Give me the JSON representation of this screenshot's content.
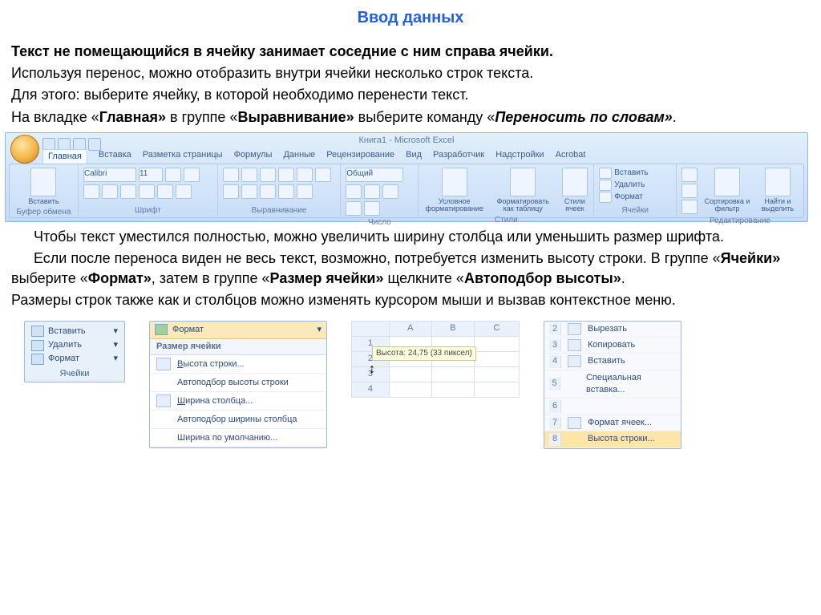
{
  "title": "Ввод данных",
  "para1_bold": "Текст не помещающийся в ячейку занимает соседние с ним справа ячейки.",
  "para2": "Используя перенос, можно отобразить внутри ячейки несколько строк текста.",
  "para3": "Для этого: выберите ячейку, в которой необходимо перенести текст.",
  "para4_prefix": "На вкладке «",
  "para4_b1": "Главная»",
  "para4_mid": " в группе «",
  "para4_b2": "Выравнивание»",
  "para4_mid2": " выберите команду «",
  "para4_bi": "Переносить по словам»",
  "para4_suffix": ".",
  "ribbon": {
    "window_title": "Книга1 - Microsoft Excel",
    "tabs": [
      "Главная",
      "Вставка",
      "Разметка страницы",
      "Формулы",
      "Данные",
      "Рецензирование",
      "Вид",
      "Разработчик",
      "Надстройки",
      "Acrobat"
    ],
    "groups": [
      "Буфер обмена",
      "Шрифт",
      "Выравнивание",
      "Число",
      "Стили",
      "Ячейки",
      "Редактирование"
    ],
    "big_labels": {
      "paste": "Вставить",
      "cond": "Условное форматирование",
      "fmt_tbl": "Форматировать как таблицу",
      "styles": "Стили ячеек",
      "sort": "Сортировка и фильтр",
      "find": "Найти и выделить"
    },
    "cell_ops": [
      "Вставить",
      "Удалить",
      "Формат"
    ],
    "font_name": "Calibri",
    "font_size": "11",
    "number_fmt": "Общий"
  },
  "para5_a": "Чтобы текст уместился полностью, можно увеличить ширину столбца или уменьшить размер шрифта.",
  "para6_a": "Если после переноса виден не весь текст, возможно, потребуется изменить высоту строки. В группе «",
  "para6_b1": "Ячейки»",
  "para6_m1": " выберите «",
  "para6_b2": "Формат»",
  "para6_m2": ", затем в группе «",
  "para6_b3": "Размер ячейки»",
  "para6_m3": " щелкните «",
  "para6_b4": "Автоподбор высоты»",
  "para6_suffix": ".",
  "para7": "Размеры строк также как и столбцов можно изменять курсором мыши и вызвав контекстное меню.",
  "cells_group": {
    "insert": "Вставить",
    "delete": "Удалить",
    "format": "Формат",
    "label": "Ячейки"
  },
  "format_menu": {
    "header": "Формат",
    "section": "Размер ячейки",
    "items": [
      "Высота строки...",
      "Автоподбор высоты строки",
      "Ширина столбца...",
      "Автоподбор ширины столбца",
      "Ширина по умолчанию..."
    ]
  },
  "sheet": {
    "cols": [
      "",
      "A",
      "B",
      "C"
    ],
    "rows": [
      "1",
      "2",
      "3",
      "4"
    ],
    "tooltip": "Высота: 24,75 (33 пиксел)"
  },
  "ctx": {
    "nums": [
      "2",
      "3",
      "4",
      "5",
      "6",
      "7",
      "8"
    ],
    "items": [
      "Вырезать",
      "Копировать",
      "Вставить",
      "Специальная вставка...",
      "",
      "Формат ячеек...",
      "Высота строки..."
    ]
  }
}
